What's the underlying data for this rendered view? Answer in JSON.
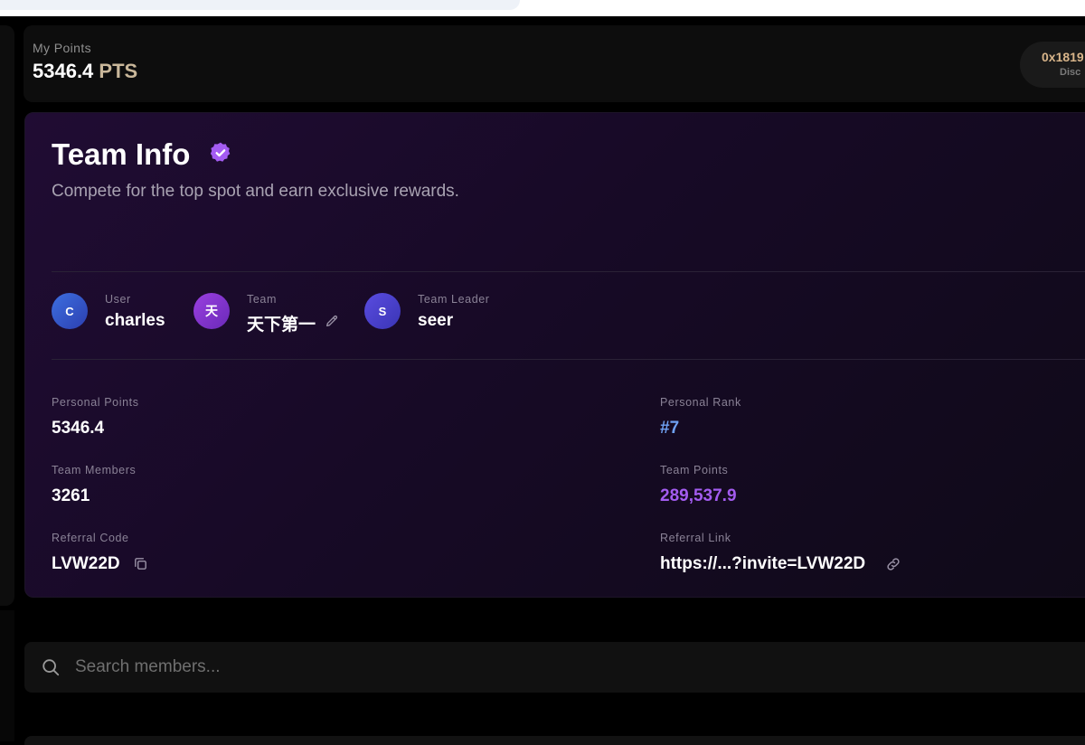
{
  "header": {
    "points_label": "My Points",
    "points_value": "5346.4",
    "points_unit": "PTS",
    "wallet_address": "0x1819",
    "wallet_sub": "Disc"
  },
  "team_card": {
    "title": "Team Info",
    "subtitle": "Compete for the top spot and earn exclusive rewards.",
    "user": {
      "label": "User",
      "name": "charles",
      "avatar_initial": "C"
    },
    "team": {
      "label": "Team",
      "name": "天下第一",
      "avatar_initial": "天"
    },
    "leader": {
      "label": "Team Leader",
      "name": "seer",
      "avatar_initial": "S"
    },
    "stats": {
      "personal_points": {
        "label": "Personal Points",
        "value": "5346.4"
      },
      "personal_rank": {
        "label": "Personal Rank",
        "value": "#7"
      },
      "team_members": {
        "label": "Team Members",
        "value": "3261"
      },
      "team_points": {
        "label": "Team Points",
        "value": "289,537.9"
      },
      "referral_code": {
        "label": "Referral Code",
        "value": "LVW22D"
      },
      "referral_link": {
        "label": "Referral Link",
        "value": "https://...?invite=LVW22D"
      }
    }
  },
  "search": {
    "placeholder": "Search members...",
    "value": ""
  },
  "colors": {
    "accent_purple": "#a35cf0",
    "rank_blue": "#6fa1f2",
    "points_unit": "#c9b79a",
    "wallet_text": "#d8b58a"
  },
  "icons": [
    "verified-badge-icon",
    "edit-pencil-icon",
    "copy-icon",
    "link-icon",
    "search-icon"
  ]
}
